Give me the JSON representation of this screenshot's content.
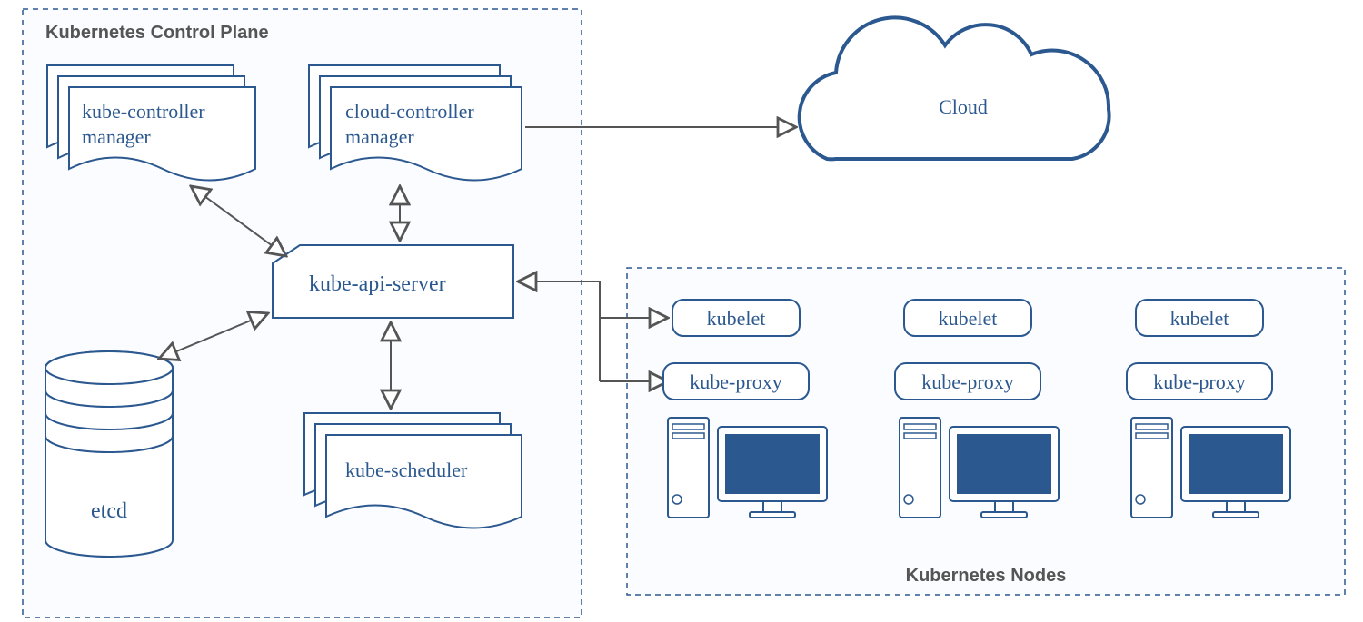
{
  "diagram": {
    "control_plane_title": "Kubernetes Control Plane",
    "nodes_title": "Kubernetes Nodes",
    "cloud_label": "Cloud",
    "components": {
      "kube_controller_manager_l1": "kube-controller",
      "kube_controller_manager_l2": "manager",
      "cloud_controller_manager_l1": "cloud-controller",
      "cloud_controller_manager_l2": "manager",
      "kube_api_server": "kube-api-server",
      "kube_scheduler": "kube-scheduler",
      "etcd": "etcd"
    },
    "node": {
      "kubelet": "kubelet",
      "kube_proxy": "kube-proxy"
    }
  }
}
